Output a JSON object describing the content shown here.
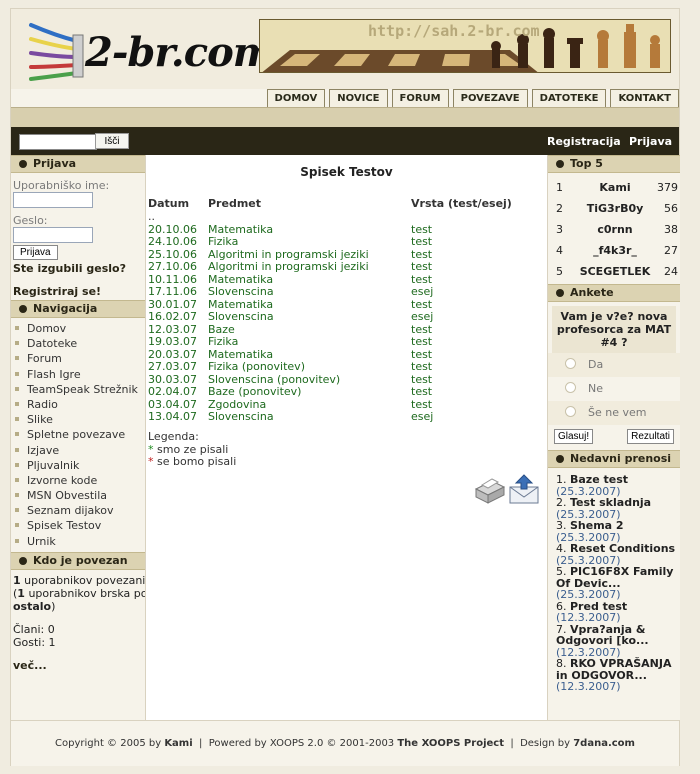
{
  "header": {
    "logo_text": "2-br.com",
    "banner_url": "http://sah.2-br.com"
  },
  "nav": [
    "DOMOV",
    "NOVICE",
    "FORUM",
    "POVEZAVE",
    "DATOTEKE",
    "KONTAKT"
  ],
  "topbar": {
    "search_button": "Išči",
    "register": "Registracija",
    "login": "Prijava"
  },
  "login": {
    "title": "Prijava",
    "username_label": "Uporabniško ime:",
    "password_label": "Geslo:",
    "submit": "Prijava",
    "lost": "Ste izgubili geslo?",
    "register": "Registriraj se!"
  },
  "navigation": {
    "title": "Navigacija",
    "items": [
      "Domov",
      "Datoteke",
      "Forum",
      "Flash Igre",
      "TeamSpeak Strežnik",
      "Radio",
      "Slike",
      "Spletne povezave",
      "Izjave",
      "Pljuvalnik",
      "Izvorne kode",
      "MSN Obvestila",
      "Seznam dijakov",
      "Spisek Testov",
      "Urnik"
    ]
  },
  "online": {
    "title": "Kdo je povezan",
    "count_users": "1",
    "users_text": " uporabnikov povezanih",
    "browse_open": "(",
    "browse_count": "1",
    "browse_text": " uporabnikov brska po",
    "browse_where": "ostalo",
    "browse_close": ")",
    "members": "Člani: 0",
    "guests": "Gosti: 1",
    "more": "več..."
  },
  "tests": {
    "title": "Spisek Testov",
    "headers": [
      "Datum",
      "Predmet",
      "Vrsta (test/esej)"
    ],
    "dotdot": "..",
    "rows": [
      [
        "20.10.06",
        "Matematika",
        "test"
      ],
      [
        "24.10.06",
        "Fizika",
        "test"
      ],
      [
        "25.10.06",
        "Algoritmi in programski jeziki",
        "test"
      ],
      [
        "27.10.06",
        "Algoritmi in programski jeziki",
        "test"
      ],
      [
        "10.11.06",
        "Matematika",
        "test"
      ],
      [
        "17.11.06",
        "Slovenscina",
        "esej"
      ],
      [
        "30.01.07",
        "Matematika",
        "test"
      ],
      [
        "16.02.07",
        "Slovenscina",
        "esej"
      ],
      [
        "12.03.07",
        "Baze",
        "test"
      ],
      [
        "19.03.07",
        "Fizika",
        "test"
      ],
      [
        "20.03.07",
        "Matematika",
        "test"
      ],
      [
        "27.03.07",
        "Fizika (ponovitev)",
        "test"
      ],
      [
        "30.03.07",
        "Slovenscina (ponovitev)",
        "test"
      ],
      [
        "02.04.07",
        "Baze (ponovitev)",
        "test"
      ],
      [
        "03.04.07",
        "Zgodovina",
        "test"
      ],
      [
        "13.04.07",
        "Slovenscina",
        "esej"
      ]
    ],
    "legend_title": "Legenda:",
    "legend": [
      {
        "mark": "*",
        "text": " smo ze pisali",
        "color": "#1e8a1e"
      },
      {
        "mark": "*",
        "text": " se bomo pisali",
        "color": "#c02020"
      }
    ]
  },
  "top5": {
    "title": "Top 5",
    "rows": [
      [
        "1",
        "Kami",
        "379"
      ],
      [
        "2",
        "TiG3rB0y",
        "56"
      ],
      [
        "3",
        "c0rnn",
        "38"
      ],
      [
        "4",
        "_f4k3r_",
        "27"
      ],
      [
        "5",
        "SCEGETLEK",
        "24"
      ]
    ]
  },
  "poll": {
    "title": "Ankete",
    "question": "Vam je v?e? nova profesorca za MAT #4 ?",
    "options": [
      "Da",
      "Ne",
      "Še ne vem"
    ],
    "vote": "Glasuj!",
    "results": "Rezultati"
  },
  "downloads": {
    "title": "Nedavni prenosi",
    "items": [
      {
        "n": "1.",
        "name": "Baze test",
        "date": "(25.3.2007)"
      },
      {
        "n": "2.",
        "name": "Test skladnja",
        "date": "(25.3.2007)"
      },
      {
        "n": "3.",
        "name": "Shema 2",
        "date": "(25.3.2007)"
      },
      {
        "n": "4.",
        "name": "Reset Conditions",
        "date": "(25.3.2007)"
      },
      {
        "n": "5.",
        "name": "PIC16F8X Family Of Devic...",
        "date": "(25.3.2007)"
      },
      {
        "n": "6.",
        "name": "Pred test",
        "date": "(12.3.2007)"
      },
      {
        "n": "7.",
        "name": "Vpra?anja & Odgovori [ko...",
        "date": "(12.3.2007)"
      },
      {
        "n": "8.",
        "name": "RKO VPRAŠANJA in ODGOVOR...",
        "date": "(12.3.2007)"
      }
    ]
  },
  "footer": {
    "copyright": "Copyright © 2005 by ",
    "author": "Kami",
    "sep1": "  |  Powered by XOOPS 2.0 © 2001-2003 ",
    "xoops": "The XOOPS Project",
    "sep2": "  |  Design by ",
    "design": "7dana.com"
  }
}
